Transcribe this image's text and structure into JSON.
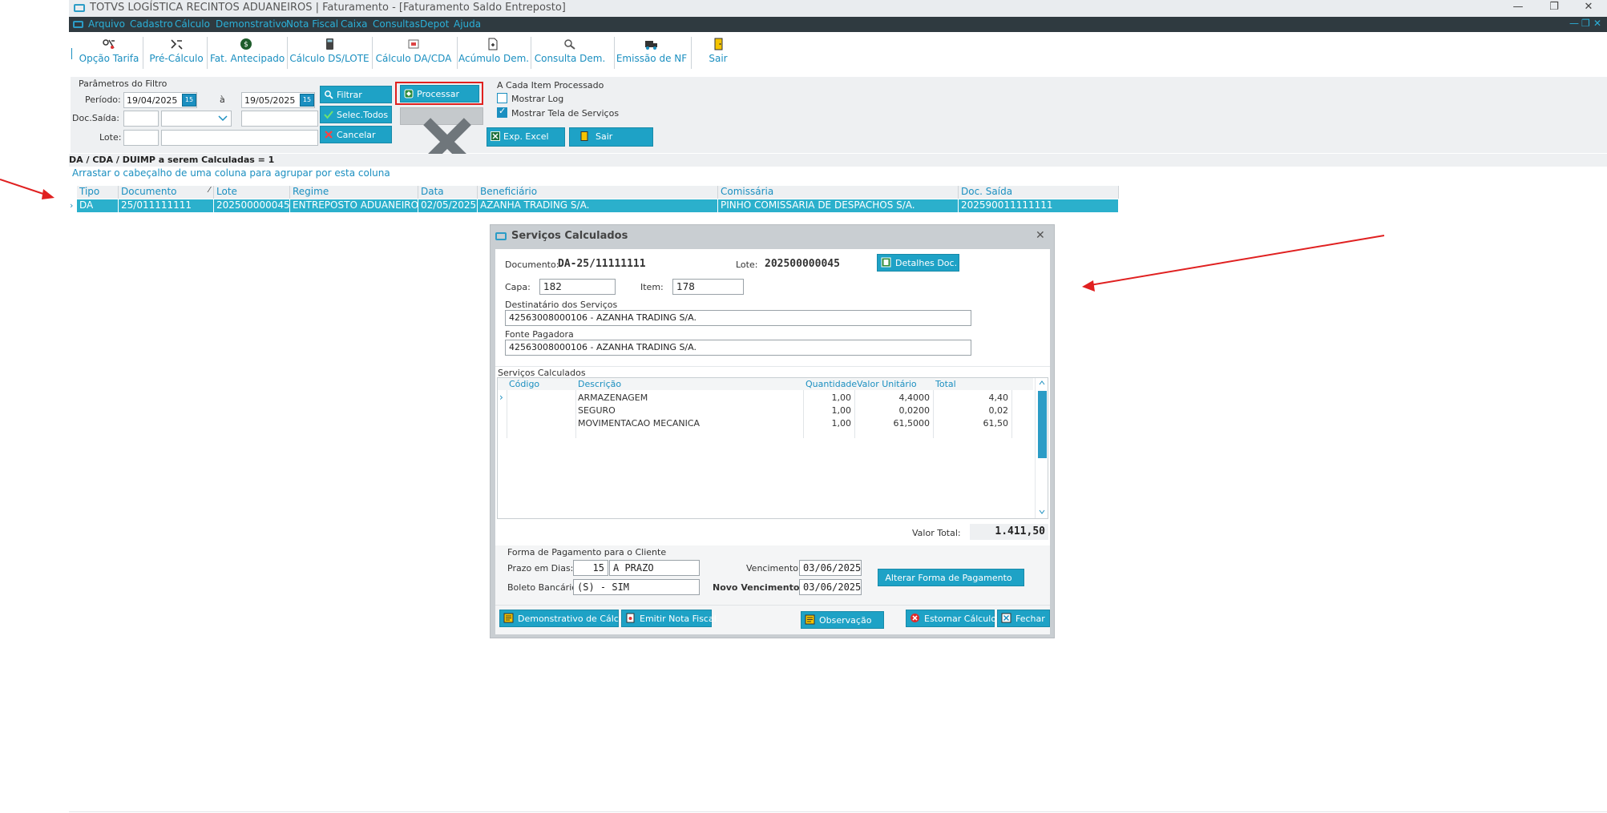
{
  "window": {
    "title": "TOTVS LOGÍSTICA RECINTOS ADUANEIROS | Faturamento - [Faturamento Saldo Entreposto]",
    "controls": [
      "—",
      "❐",
      "✕"
    ]
  },
  "menu": {
    "items": [
      "Arquivo",
      "Cadastro",
      "Cálculo",
      "Demonstrativo",
      "Nota Fiscal",
      "Caixa",
      "Consultas",
      "Depot",
      "Ajuda"
    ],
    "mdi_controls": [
      "—",
      "❐",
      "✕"
    ]
  },
  "toolbar": {
    "buttons": [
      "Opção Tarifa",
      "Pré-Cálculo",
      "Fat. Antecipado",
      "Cálculo DS/LOTE",
      "Cálculo DA/CDA",
      "Acúmulo Dem.",
      "Consulta Dem.",
      "Emissão de NF",
      "Sair"
    ]
  },
  "filter": {
    "group_title": "Parâmetros do Filtro",
    "periodo_label": "Período:",
    "date_from": "19/04/2025",
    "a_label": "à",
    "date_to": "19/05/2025",
    "cal_icon_text": "15",
    "doc_saida_label": "Doc.Saída:",
    "lote_label": "Lote:",
    "btn_filtrar": "Filtrar",
    "btn_selec_todos": "Selec.Todos",
    "btn_cancelar": "Cancelar",
    "btn_processar": "Processar",
    "btn_cancelar2": "Cancelar",
    "each_item_title": "A Cada Item Processado",
    "chk_mostrar_log": "Mostrar Log",
    "chk_mostrar_tela": "Mostrar Tela de Serviços",
    "chk_mostrar_log_checked": false,
    "chk_mostrar_tela_checked": true,
    "btn_exp_excel": "Exp. Excel",
    "btn_sair": "Sair"
  },
  "grid": {
    "count_text": "DA / CDA / DUIMP a serem Calculadas = 1",
    "group_hint": "Arrastar o cabeçalho de uma coluna para agrupar por esta coluna",
    "headers": [
      "Tipo",
      "Documento",
      "Lote",
      "Regime",
      "Data",
      "Beneficiário",
      "Comissária",
      "Doc. Saída"
    ],
    "rows": [
      [
        "DA",
        "25/011111111",
        "202500000045",
        "ENTREPOSTO ADUANEIRO",
        "02/05/2025",
        "AZANHA TRADING S/A.",
        "PINHO COMISSARIA DE DESPACHOS S/A.",
        "202590011111111"
      ]
    ]
  },
  "dialog": {
    "title": "Serviços Calculados",
    "documento_label": "Documento:",
    "documento_value": "DA-25/11111111",
    "lote_label": "Lote:",
    "lote_value": "202500000045",
    "btn_detalhes": "Detalhes Doc.",
    "capa_label": "Capa:",
    "capa_value": "182",
    "item_label": "Item:",
    "item_value": "178",
    "destinatario_label": "Destinatário dos Serviços",
    "destinatario_value": "42563008000106 - AZANHA TRADING S/A.",
    "fonte_label": "Fonte Pagadora",
    "fonte_value": "42563008000106 - AZANHA TRADING S/A.",
    "servicos_label": "Serviços Calculados",
    "services_headers": [
      "Código",
      "Descrição",
      "Quantidade",
      "Valor Unitário",
      "Total"
    ],
    "services": [
      {
        "codigo": "",
        "descricao": "ARMAZENAGEM",
        "quantidade": "1,00",
        "valor_unitario": "4,4000",
        "total": "4,40"
      },
      {
        "codigo": "",
        "descricao": "SEGURO",
        "quantidade": "1,00",
        "valor_unitario": "0,0200",
        "total": "0,02"
      },
      {
        "codigo": "",
        "descricao": "MOVIMENTACAO MECANICA",
        "quantidade": "1,00",
        "valor_unitario": "61,5000",
        "total": "61,50"
      }
    ],
    "valor_total_label": "Valor Total:",
    "valor_total": "1.411,50",
    "forma_pagamento_label": "Forma de Pagamento para o Cliente",
    "prazo_label": "Prazo em  Dias:",
    "prazo_dias": "15",
    "prazo_tipo": "A PRAZO",
    "boleto_label": "Boleto Bancário:",
    "boleto_value": "(S) - SIM",
    "vencimento_label": "Vencimento:",
    "vencimento_value": "03/06/2025",
    "novo_vencimento_label": "Novo Vencimento:",
    "novo_vencimento_value": "03/06/2025",
    "btn_alterar_forma": "Alterar Forma de Pagamento",
    "btn_demonstrativo": "Demonstrativo de Cálculo",
    "btn_emitir_nf": "Emitir Nota Fiscal",
    "btn_observacao": "Observação",
    "btn_estornar": "Estornar Cálculo",
    "btn_fechar": "Fechar",
    "close_icon": "✕"
  }
}
